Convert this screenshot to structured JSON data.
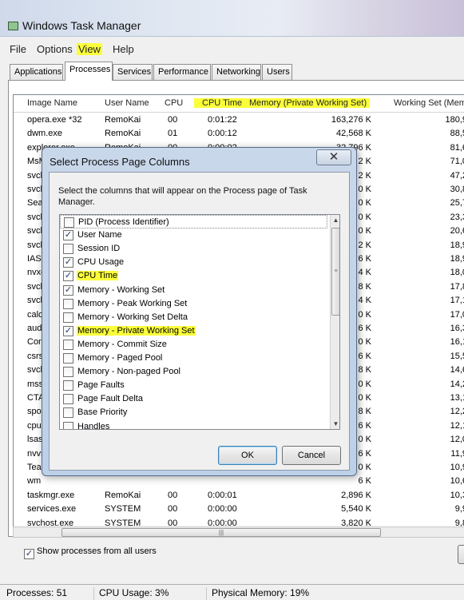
{
  "window": {
    "title": "Windows Task Manager"
  },
  "menu": [
    "File",
    "Options",
    "View",
    "Help"
  ],
  "tabs": [
    "Applications",
    "Processes",
    "Services",
    "Performance",
    "Networking",
    "Users"
  ],
  "columns": [
    "Image Name",
    "User Name",
    "CPU",
    "CPU Time",
    "Memory (Private Working Set)",
    "Working Set (Mem"
  ],
  "processes": [
    [
      "opera.exe *32",
      "RemoKai",
      "00",
      "0:01:22",
      "163,276 K",
      "180,9"
    ],
    [
      "dwm.exe",
      "RemoKai",
      "01",
      "0:00:12",
      "42,568 K",
      "88,5"
    ],
    [
      "explorer.exe",
      "RemoKai",
      "00",
      "0:00:02",
      "32,796 K",
      "81,6"
    ],
    [
      "MsM",
      "",
      "",
      "",
      "2 K",
      "71,0"
    ],
    [
      "svch",
      "",
      "",
      "",
      "2 K",
      "47,2"
    ],
    [
      "svch",
      "",
      "",
      "",
      "0 K",
      "30,8"
    ],
    [
      "Sea",
      "",
      "",
      "",
      "0 K",
      "25,7"
    ],
    [
      "svch",
      "",
      "",
      "",
      "0 K",
      "23,3"
    ],
    [
      "svch",
      "",
      "",
      "",
      "0 K",
      "20,6"
    ],
    [
      "svch",
      "",
      "",
      "",
      "2 K",
      "18,9"
    ],
    [
      "IASt",
      "",
      "",
      "",
      "6 K",
      "18,9"
    ],
    [
      "nvxd",
      "",
      "",
      "",
      "4 K",
      "18,0"
    ],
    [
      "svch",
      "",
      "",
      "",
      "8 K",
      "17,8"
    ],
    [
      "svch",
      "",
      "",
      "",
      "4 K",
      "17,1"
    ],
    [
      "calc",
      "",
      "",
      "",
      "0 K",
      "17,0"
    ],
    [
      "aud",
      "",
      "",
      "",
      "6 K",
      "16,3"
    ],
    [
      "Core",
      "",
      "",
      "",
      "0 K",
      "16,1"
    ],
    [
      "csrs",
      "",
      "",
      "",
      "6 K",
      "15,5"
    ],
    [
      "svch",
      "",
      "",
      "",
      "8 K",
      "14,6"
    ],
    [
      "mss",
      "",
      "",
      "",
      "0 K",
      "14,2"
    ],
    [
      "CTA",
      "",
      "",
      "",
      "0 K",
      "13,1"
    ],
    [
      "spoo",
      "",
      "",
      "",
      "8 K",
      "12,2"
    ],
    [
      "cpuz",
      "",
      "",
      "",
      "6 K",
      "12,1"
    ],
    [
      "lsas",
      "",
      "",
      "",
      "0 K",
      "12,0"
    ],
    [
      "nvvs",
      "",
      "",
      "",
      "6 K",
      "11,9"
    ],
    [
      "Tea",
      "",
      "",
      "",
      "0 K",
      "10,9"
    ],
    [
      "wm",
      "",
      "",
      "",
      "6 K",
      "10,6"
    ],
    [
      "taskmgr.exe",
      "RemoKai",
      "00",
      "0:00:01",
      "2,896 K",
      "10,3"
    ],
    [
      "services.exe",
      "SYSTEM",
      "00",
      "0:00:00",
      "5,540 K",
      "9,9"
    ],
    [
      "svchost.exe",
      "SYSTEM",
      "00",
      "0:00:00",
      "3,820 K",
      "9,8"
    ]
  ],
  "show_all_label": "Show processes from all users",
  "show_all_checked": true,
  "status": {
    "processes": "Processes: 51",
    "cpu": "CPU Usage: 3%",
    "memory": "Physical Memory: 19%"
  },
  "dialog": {
    "title": "Select Process Page Columns",
    "description": "Select the columns that will appear on the Process page of Task Manager.",
    "ok": "OK",
    "cancel": "Cancel",
    "items": [
      {
        "label": "PID (Process Identifier)",
        "checked": false
      },
      {
        "label": "User Name",
        "checked": true
      },
      {
        "label": "Session ID",
        "checked": false
      },
      {
        "label": "CPU Usage",
        "checked": true
      },
      {
        "label": "CPU Time",
        "checked": true
      },
      {
        "label": "Memory - Working Set",
        "checked": true
      },
      {
        "label": "Memory - Peak Working Set",
        "checked": false
      },
      {
        "label": "Memory - Working Set Delta",
        "checked": false
      },
      {
        "label": "Memory - Private Working Set",
        "checked": true
      },
      {
        "label": "Memory - Commit Size",
        "checked": false
      },
      {
        "label": "Memory - Paged Pool",
        "checked": false
      },
      {
        "label": "Memory - Non-paged Pool",
        "checked": false
      },
      {
        "label": "Page Faults",
        "checked": false
      },
      {
        "label": "Page Fault Delta",
        "checked": false
      },
      {
        "label": "Base Priority",
        "checked": false
      },
      {
        "label": "Handles",
        "checked": false
      }
    ]
  },
  "highlight_color": "#fbff3a"
}
